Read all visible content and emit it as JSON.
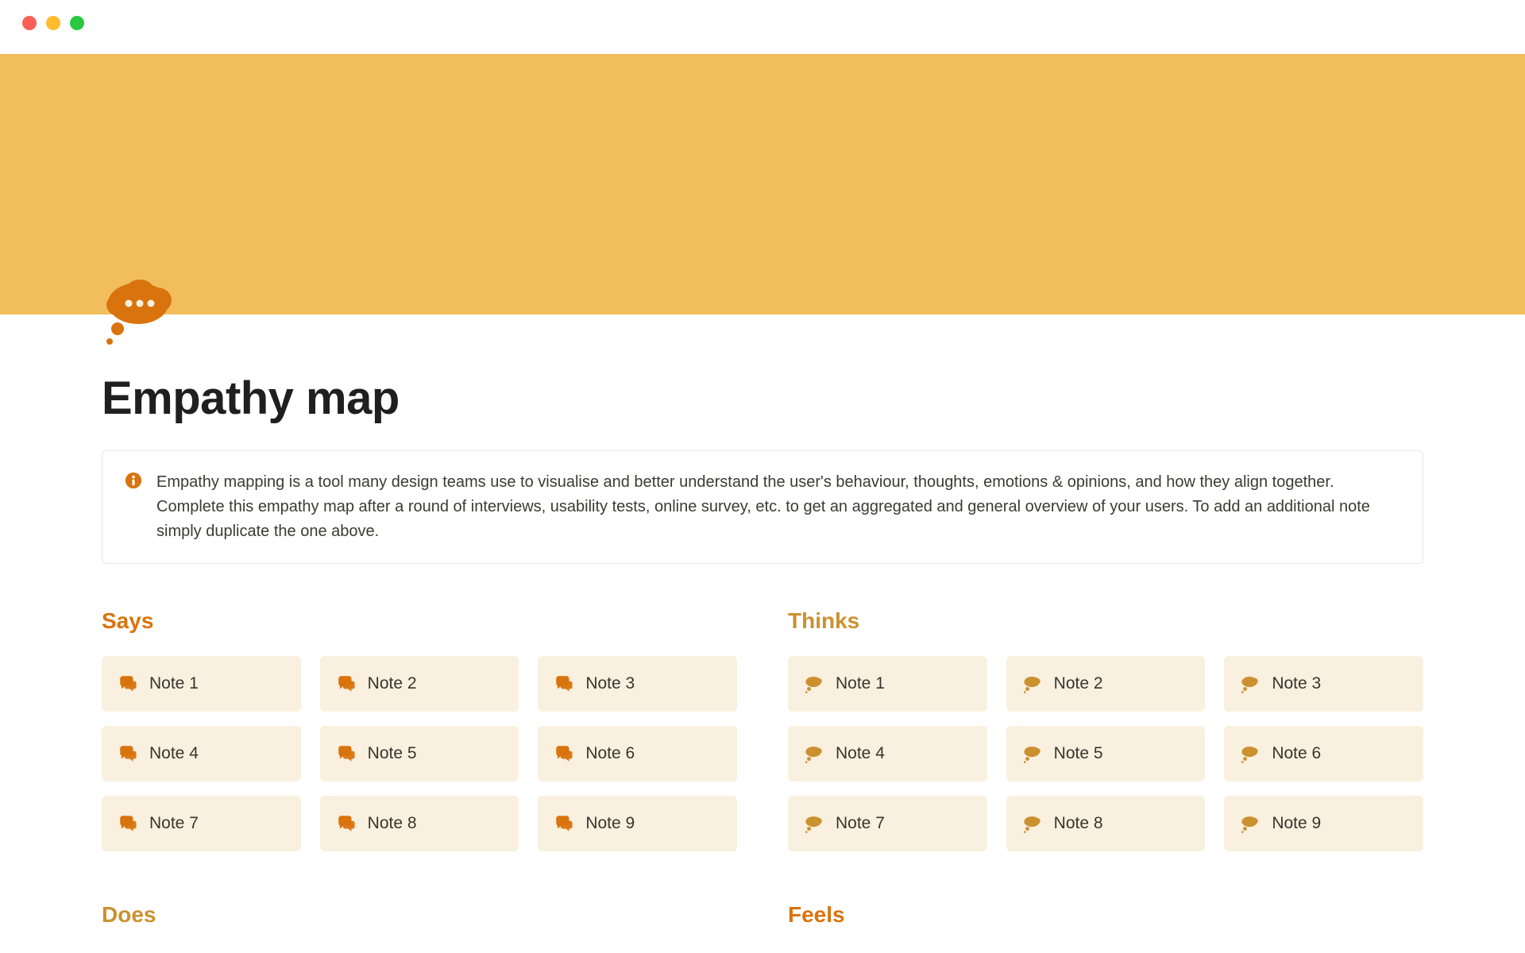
{
  "page": {
    "title": "Empathy map",
    "callout": "Empathy mapping is a tool many design teams use to visualise and better understand the user's behaviour, thoughts, emotions & opinions, and how they align together. Complete this empathy map after a round of interviews, usability tests, online survey, etc. to get an aggregated and general overview of your users. To add an additional note simply duplicate the one above."
  },
  "colors": {
    "banner": "#f1bd5d",
    "orange": "#d9730d",
    "yellow": "#cb912f",
    "note_bg": "#f9f0df"
  },
  "sections": {
    "says": {
      "heading": "Says",
      "icon": "speech-bubbles-icon",
      "notes": [
        "Note 1",
        "Note 2",
        "Note 3",
        "Note 4",
        "Note 5",
        "Note 6",
        "Note 7",
        "Note 8",
        "Note 9"
      ]
    },
    "thinks": {
      "heading": "Thinks",
      "icon": "thought-cloud-icon",
      "notes": [
        "Note 1",
        "Note 2",
        "Note 3",
        "Note 4",
        "Note 5",
        "Note 6",
        "Note 7",
        "Note 8",
        "Note 9"
      ]
    },
    "does": {
      "heading": "Does"
    },
    "feels": {
      "heading": "Feels"
    }
  }
}
